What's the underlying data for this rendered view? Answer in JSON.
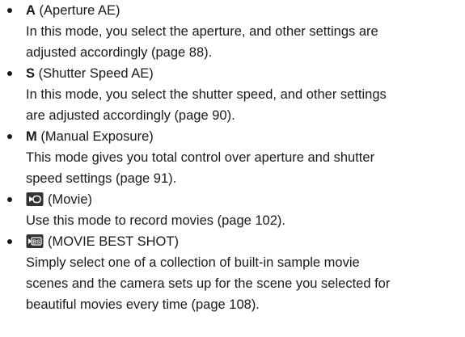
{
  "modes": [
    {
      "key": "A",
      "name": "(Aperture AE)",
      "description_lines": [
        "In this mode, you select the aperture, and other settings are",
        "adjusted accordingly (page 88)."
      ]
    },
    {
      "key": "S",
      "name": "(Shutter Speed AE)",
      "description_lines": [
        "In this mode, you select the shutter speed, and other settings",
        "are adjusted accordingly (page 90)."
      ]
    },
    {
      "key": "M",
      "name": "(Manual Exposure)",
      "description_lines": [
        "This mode gives you total control over aperture and shutter",
        "speed settings (page 91)."
      ]
    },
    {
      "icon": "movie-camera-icon",
      "name": "(Movie)",
      "description_lines": [
        "Use this mode to record movies (page 102)."
      ]
    },
    {
      "icon": "movie-best-shot-icon",
      "icon_text": "BS",
      "name": "(MOVIE BEST SHOT)",
      "description_lines": [
        "Simply select one of a collection of built-in sample movie",
        "scenes and the camera sets up for the scene you selected for",
        "beautiful movies every time (page 108)."
      ]
    }
  ],
  "colors": {
    "text": "#1a1a1a",
    "icon_fill": "#333333"
  }
}
